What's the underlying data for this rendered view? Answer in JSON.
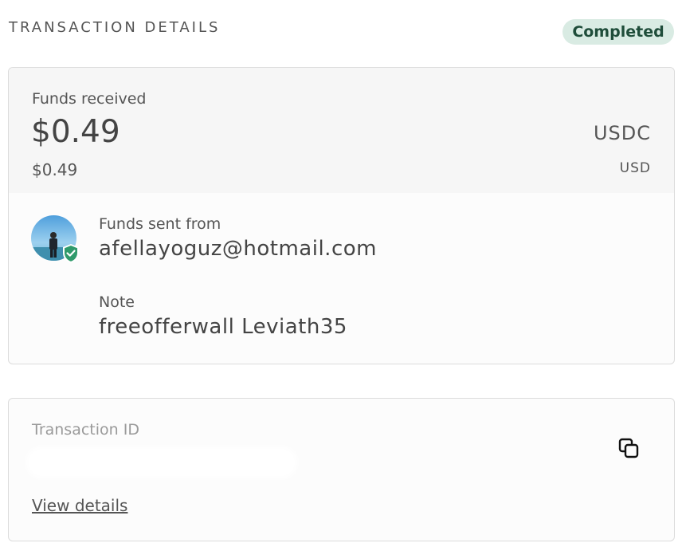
{
  "header": {
    "title": "TRANSACTION DETAILS",
    "status": "Completed"
  },
  "amount": {
    "label": "Funds received",
    "value": "$0.49",
    "currency": "USDC",
    "converted_value": "$0.49",
    "converted_currency": "USD"
  },
  "sender": {
    "label": "Funds sent from",
    "value": "afellayoguz@hotmail.com",
    "avatar_icon": "user-avatar",
    "verified_icon": "shield-check-icon"
  },
  "note": {
    "label": "Note",
    "value": "freeofferwall Leviath35"
  },
  "transaction": {
    "id_label": "Transaction ID",
    "copy_icon": "copy-icon",
    "view_details_label": "View details"
  },
  "colors": {
    "status_bg": "#d9ebe3",
    "status_text": "#1f4d3a",
    "shield": "#2f9a6b"
  }
}
